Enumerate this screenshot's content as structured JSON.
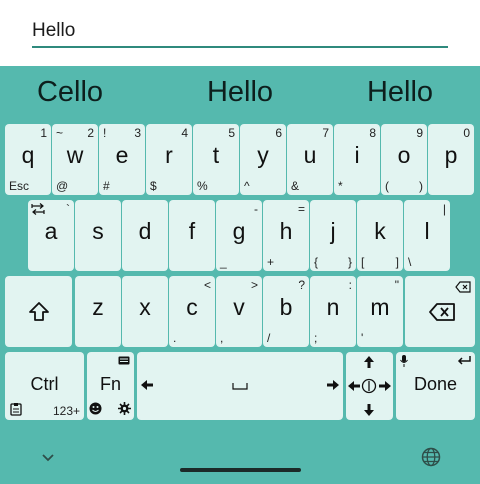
{
  "input": {
    "value": "Hello"
  },
  "suggestions": [
    "Cello",
    "Hello",
    "Hello"
  ],
  "row1": [
    {
      "label": "q",
      "tr": "1",
      "bl": "Esc"
    },
    {
      "label": "w",
      "tl": "~",
      "tr": "2",
      "bl": "@"
    },
    {
      "label": "e",
      "tl": "!",
      "tr": "3",
      "bl": "#"
    },
    {
      "label": "r",
      "tr": "4",
      "bl": "$"
    },
    {
      "label": "t",
      "tr": "5",
      "bl": "%"
    },
    {
      "label": "y",
      "tr": "6",
      "bl": "^"
    },
    {
      "label": "u",
      "tr": "7",
      "bl": "&"
    },
    {
      "label": "i",
      "tr": "8",
      "bl": "*"
    },
    {
      "label": "o",
      "tr": "9",
      "bl": "(",
      "br": ")"
    },
    {
      "label": "p",
      "tr": "0"
    }
  ],
  "row2": [
    {
      "label": "a",
      "tr": "`"
    },
    {
      "label": "s"
    },
    {
      "label": "d"
    },
    {
      "label": "f"
    },
    {
      "label": "g",
      "tr": "-",
      "bl": "_"
    },
    {
      "label": "h",
      "tr": "=",
      "bl": "+"
    },
    {
      "label": "j",
      "bl": "{",
      "br": "}"
    },
    {
      "label": "k",
      "bl": "[",
      "br": "]"
    },
    {
      "label": "l",
      "tr": "|",
      "bl": "\\"
    }
  ],
  "row3": [
    {
      "label": "z"
    },
    {
      "label": "x"
    },
    {
      "label": "c",
      "tr": "<",
      "bl": "."
    },
    {
      "label": "v",
      "tr": ">",
      "bl": ","
    },
    {
      "label": "b",
      "tr": "?",
      "bl": "/"
    },
    {
      "label": "n",
      "tr": ":",
      "bl": ";"
    },
    {
      "label": "m",
      "tr": "\"",
      "bl": "'"
    }
  ],
  "row4": {
    "ctrl_label": "Ctrl",
    "numeric_label": "123+",
    "fn_label": "Fn",
    "done_label": "Done"
  },
  "colors": {
    "keyboard_bg": "#55b9ae",
    "key_bg": "#e2f4f1",
    "accent": "#2f8a7d"
  }
}
